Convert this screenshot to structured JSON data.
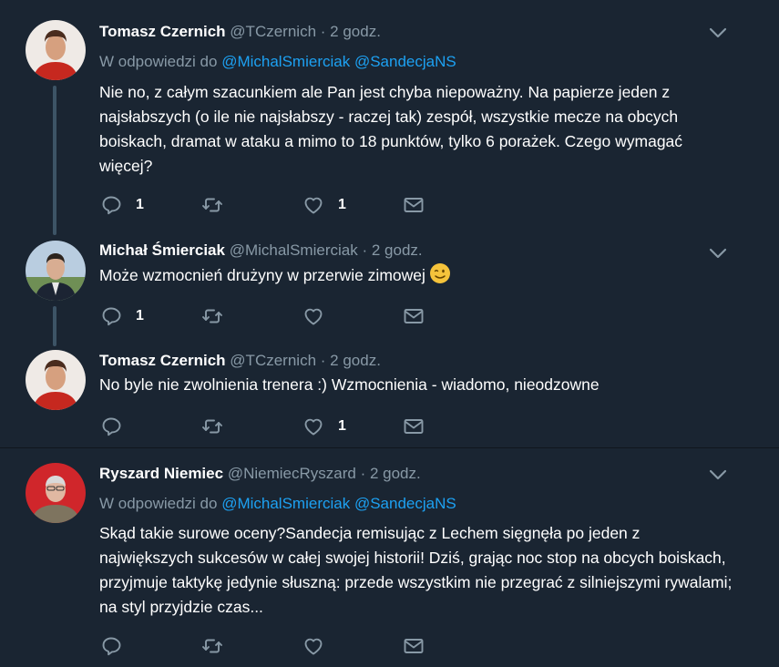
{
  "tweets": [
    {
      "name": "Tomasz Czernich",
      "handle": "@TCzernich",
      "dot": "·",
      "time": "2 godz.",
      "reply_prefix": "W odpowiedzi do",
      "mention1": "@MichalSmierciak",
      "mention2": "@SandecjaNS",
      "text": "Nie no, z całym szacunkiem ale Pan jest chyba niepoważny. Na papierze jeden z najsłabszych (o ile nie najsłabszy - raczej tak) zespół, wszystkie mecze na obcych boiskach, dramat w ataku a mimo to 18 punktów, tylko 6 porażek. Czego wymagać więcej?",
      "replies": "1",
      "retweets": "",
      "likes": "1"
    },
    {
      "name": "Michał Śmierciak",
      "handle": "@MichalSmierciak",
      "dot": "·",
      "time": "2 godz.",
      "text": "Może wzmocnień drużyny w przerwie zimowej",
      "replies": "1",
      "retweets": "",
      "likes": ""
    },
    {
      "name": "Tomasz Czernich",
      "handle": "@TCzernich",
      "dot": "·",
      "time": "2 godz.",
      "text": "No byle nie zwolnienia trenera :) Wzmocnienia - wiadomo, nieodzowne",
      "replies": "",
      "retweets": "",
      "likes": "1"
    },
    {
      "name": "Ryszard Niemiec",
      "handle": "@NiemiecRyszard",
      "dot": "·",
      "time": "2 godz.",
      "reply_prefix": "W odpowiedzi do",
      "mention1": "@MichalSmierciak",
      "mention2": "@SandecjaNS",
      "text": "Skąd takie surowe oceny?Sandecja remisując z Lechem sięgnęła po jeden z największych sukcesów w całej swojej historii! Dziś, grając noc stop na obcych boiskach, przyjmuje taktykę jedynie słuszną: przede wszystkim nie przegrać z silniejszymi rywalami; na styl przyjdzie czas...",
      "replies": "",
      "retweets": "",
      "likes": ""
    }
  ],
  "colors": {
    "background": "#1a2532",
    "secondary_text": "#8899a6",
    "link": "#1da1f2",
    "thread_line": "#3d5466"
  },
  "icons": {
    "reply": "reply-icon",
    "retweet": "retweet-icon",
    "like": "heart-icon",
    "dm": "envelope-icon",
    "menu": "chevron-down-icon",
    "emoji": "winking-face-emoji"
  }
}
